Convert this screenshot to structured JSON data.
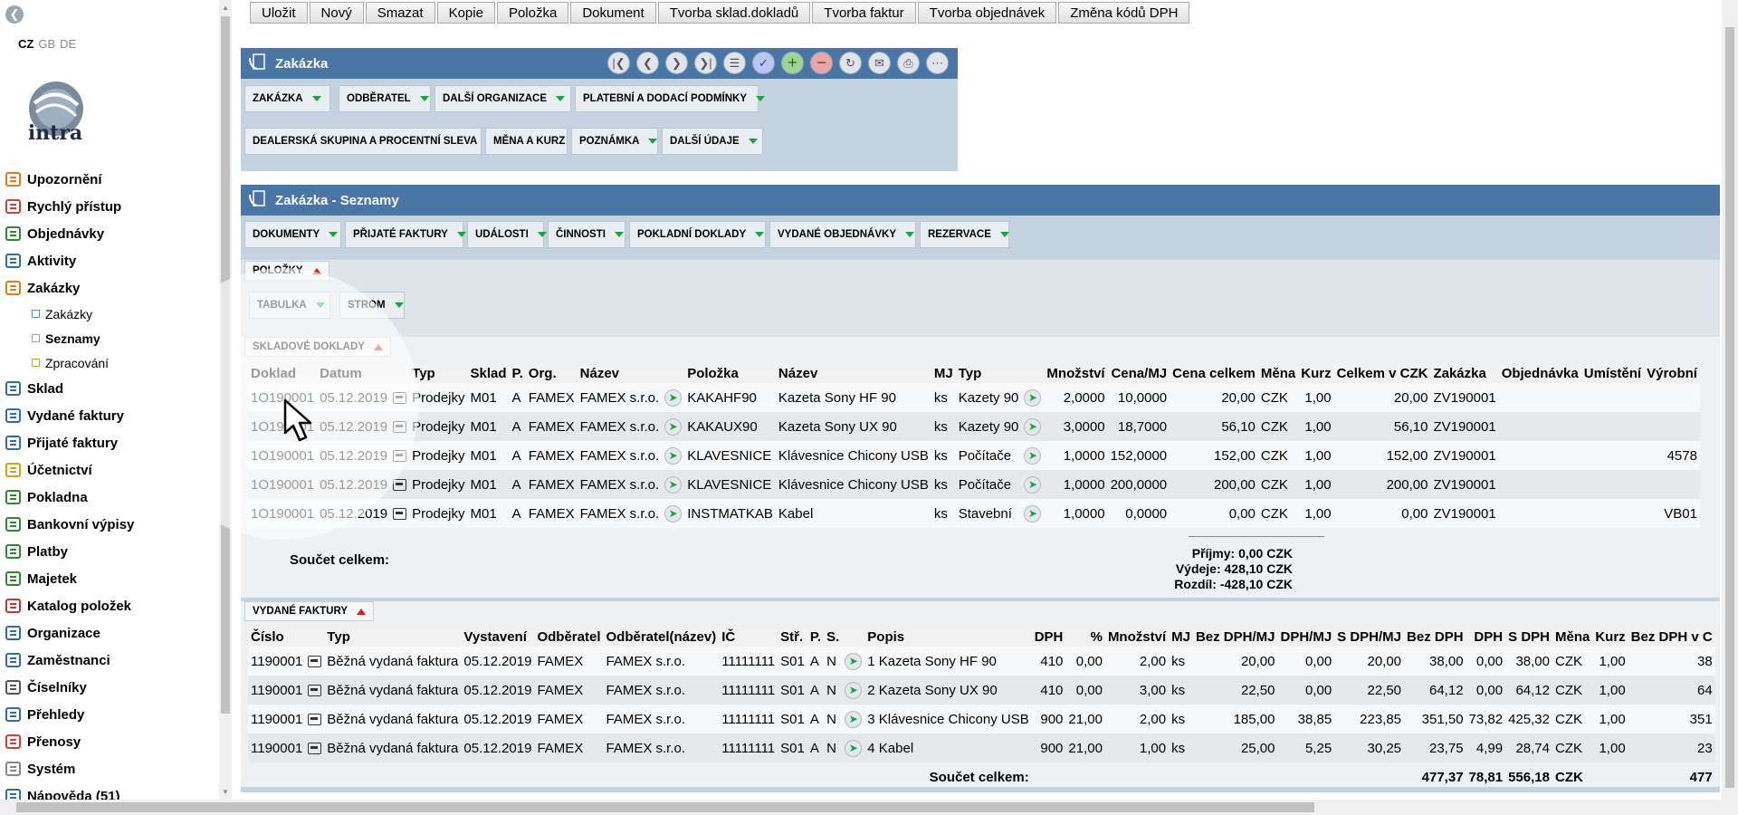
{
  "languages": [
    "CZ",
    "GB",
    "DE"
  ],
  "logo_text": "intra",
  "sidebar": {
    "items": [
      {
        "label": "Upozornění",
        "icon": "bell-icon"
      },
      {
        "label": "Rychlý přístup",
        "icon": "grid-icon"
      },
      {
        "label": "Objednávky",
        "icon": "cart-icon"
      },
      {
        "label": "Aktivity",
        "icon": "clock-icon"
      },
      {
        "label": "Zakázky",
        "icon": "order-icon"
      },
      {
        "label": "Zakázky",
        "icon": "square-icon",
        "sub": true
      },
      {
        "label": "Seznamy",
        "icon": "square-icon",
        "sub": true
      },
      {
        "label": "Zpracování",
        "icon": "square-icon",
        "sub": true
      },
      {
        "label": "Sklad",
        "icon": "warehouse-icon"
      },
      {
        "label": "Vydané faktury",
        "icon": "invoice-out-icon"
      },
      {
        "label": "Přijaté faktury",
        "icon": "invoice-in-icon"
      },
      {
        "label": "Účetnictví",
        "icon": "ledger-icon"
      },
      {
        "label": "Pokladna",
        "icon": "cashbox-icon"
      },
      {
        "label": "Bankovní výpisy",
        "icon": "bank-icon"
      },
      {
        "label": "Platby",
        "icon": "payment-icon"
      },
      {
        "label": "Majetek",
        "icon": "asset-icon"
      },
      {
        "label": "Katalog položek",
        "icon": "catalog-icon"
      },
      {
        "label": "Organizace",
        "icon": "organization-icon"
      },
      {
        "label": "Zaměstnanci",
        "icon": "employee-icon"
      },
      {
        "label": "Číselníky",
        "icon": "gear-icon"
      },
      {
        "label": "Přehledy",
        "icon": "report-icon"
      },
      {
        "label": "Přenosy",
        "icon": "transfer-icon"
      },
      {
        "label": "Systém",
        "icon": "wrench-icon"
      },
      {
        "label": "Nápověda (51)",
        "icon": "help-icon"
      }
    ]
  },
  "toolbar": [
    "Uložit",
    "Nový",
    "Smazat",
    "Kopie",
    "Položka",
    "Dokument",
    "Tvorba sklad.dokladů",
    "Tvorba faktur",
    "Tvorba objednávek",
    "Změna kódů DPH"
  ],
  "panel1": {
    "title": "Zakázka",
    "tabs_row1": [
      "ZAKÁZKA",
      "ODBĚRATEL",
      "DALŠÍ ORGANIZACE",
      "PLATEBNÍ A DODACÍ PODMÍNKY"
    ],
    "tabs_row2": [
      "DEALERSKÁ SKUPINA A PROCENTNÍ SLEVA",
      "MĚNA A KURZ",
      "POZNÁMKA",
      "DALŠÍ ÚDAJE"
    ]
  },
  "panel2": {
    "title": "Zakázka - Seznamy",
    "tabs": [
      "DOKUMENTY",
      "PŘIJATÉ FAKTURY",
      "UDÁLOSTI",
      "ČINNOSTI",
      "POKLADNÍ DOKLADY",
      "VYDANÉ OBJEDNÁVKY",
      "REZERVACE"
    ],
    "polozky_label": "POLOŽKY",
    "view_tabs": [
      "TABULKA",
      "STROM"
    ],
    "sklad_label": "SKLADOVÉ DOKLADY",
    "faktury_label": "VYDANÉ FAKTURY"
  },
  "sklad_table": {
    "headers": [
      "Doklad",
      "Datum",
      "",
      "Typ",
      "Sklad",
      "P.",
      "Org.",
      "Název",
      "",
      "Položka",
      "Název",
      "MJ",
      "Typ",
      "",
      "Množství",
      "Cena/MJ",
      "Cena celkem",
      "Měna",
      "Kurz",
      "Celkem v CZK",
      "Zakázka",
      "Objednávka",
      "Umístění",
      "Výrobní"
    ],
    "rows": [
      [
        "1O190001",
        "05.12.2019",
        "",
        "Prodejky",
        "M01",
        "A",
        "FAMEX",
        "FAMEX s.r.o.",
        "",
        "KAKAHF90",
        "Kazeta Sony HF 90",
        "ks",
        "Kazety 90",
        "",
        "2,0000",
        "10,0000",
        "20,00",
        "CZK",
        "1,00",
        "20,00",
        "ZV190001",
        "",
        "",
        ""
      ],
      [
        "1O190001",
        "05.12.2019",
        "",
        "Prodejky",
        "M01",
        "A",
        "FAMEX",
        "FAMEX s.r.o.",
        "",
        "KAKAUX90",
        "Kazeta Sony UX 90",
        "ks",
        "Kazety 90",
        "",
        "3,0000",
        "18,7000",
        "56,10",
        "CZK",
        "1,00",
        "56,10",
        "ZV190001",
        "",
        "",
        ""
      ],
      [
        "1O190001",
        "05.12.2019",
        "",
        "Prodejky",
        "M01",
        "A",
        "FAMEX",
        "FAMEX s.r.o.",
        "",
        "KLAVESNICE",
        "Klávesnice Chicony USB",
        "ks",
        "Počítače",
        "",
        "1,0000",
        "152,0000",
        "152,00",
        "CZK",
        "1,00",
        "152,00",
        "ZV190001",
        "",
        "",
        "4578"
      ],
      [
        "1O190001",
        "05.12.2019",
        "",
        "Prodejky",
        "M01",
        "A",
        "FAMEX",
        "FAMEX s.r.o.",
        "",
        "KLAVESNICE",
        "Klávesnice Chicony USB",
        "ks",
        "Počítače",
        "",
        "1,0000",
        "200,0000",
        "200,00",
        "CZK",
        "1,00",
        "200,00",
        "ZV190001",
        "",
        "",
        ""
      ],
      [
        "1O190001",
        "05.12.2019",
        "",
        "Prodejky",
        "M01",
        "A",
        "FAMEX",
        "FAMEX s.r.o.",
        "",
        "INSTMATKAB",
        "Kabel",
        "ks",
        "Stavební",
        "",
        "1,0000",
        "0,0000",
        "0,00",
        "CZK",
        "1,00",
        "0,00",
        "ZV190001",
        "",
        "",
        "VB01"
      ]
    ],
    "sum_label": "Součet celkem:",
    "sums": [
      "Příjmy: 0,00 CZK",
      "Výdeje: 428,10 CZK",
      "Rozdíl: -428,10 CZK"
    ]
  },
  "faktury_table": {
    "headers": [
      "Číslo",
      "",
      "Typ",
      "Vystavení",
      "Odběratel",
      "Odběratel(název)",
      "IČ",
      "Stř.",
      "P.",
      "S.",
      "",
      "Popis",
      "DPH",
      "%",
      "Množství",
      "MJ",
      "Bez DPH/MJ",
      "DPH/MJ",
      "S DPH/MJ",
      "Bez DPH",
      "DPH",
      "S DPH",
      "Měna",
      "Kurz",
      "Bez DPH v C"
    ],
    "rows": [
      [
        "1190001",
        "",
        "Běžná vydaná faktura",
        "05.12.2019",
        "FAMEX",
        "FAMEX s.r.o.",
        "11111111",
        "S01",
        "A",
        "N",
        "",
        "1 Kazeta Sony HF 90",
        "410",
        "0,00",
        "2,00",
        "ks",
        "20,00",
        "0,00",
        "20,00",
        "38,00",
        "0,00",
        "38,00",
        "CZK",
        "1,00",
        "38"
      ],
      [
        "1190001",
        "",
        "Běžná vydaná faktura",
        "05.12.2019",
        "FAMEX",
        "FAMEX s.r.o.",
        "11111111",
        "S01",
        "A",
        "N",
        "",
        "2 Kazeta Sony UX 90",
        "410",
        "0,00",
        "3,00",
        "ks",
        "22,50",
        "0,00",
        "22,50",
        "64,12",
        "0,00",
        "64,12",
        "CZK",
        "1,00",
        "64"
      ],
      [
        "1190001",
        "",
        "Běžná vydaná faktura",
        "05.12.2019",
        "FAMEX",
        "FAMEX s.r.o.",
        "11111111",
        "S01",
        "A",
        "N",
        "",
        "3 Klávesnice Chicony USB",
        "900",
        "21,00",
        "2,00",
        "ks",
        "185,00",
        "38,85",
        "223,85",
        "351,50",
        "73,82",
        "425,32",
        "CZK",
        "1,00",
        "351"
      ],
      [
        "1190001",
        "",
        "Běžná vydaná faktura",
        "05.12.2019",
        "FAMEX",
        "FAMEX s.r.o.",
        "11111111",
        "S01",
        "A",
        "N",
        "",
        "4 Kabel",
        "900",
        "21,00",
        "1,00",
        "ks",
        "25,00",
        "5,25",
        "30,25",
        "23,75",
        "4,99",
        "28,74",
        "CZK",
        "1,00",
        "23"
      ]
    ],
    "sum_label": "Součet celkem:",
    "sums": [
      "477,37",
      "78,81",
      "556,18",
      "CZK",
      "477"
    ]
  }
}
